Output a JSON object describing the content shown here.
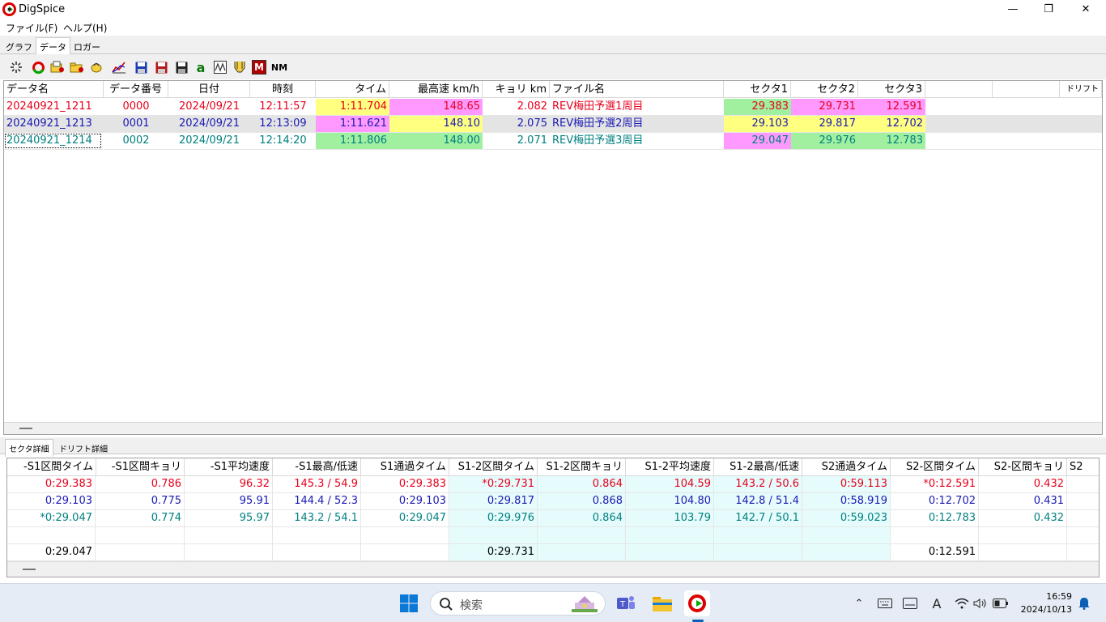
{
  "window": {
    "title": "DigSpice",
    "minimize": "—",
    "maximize": "❐",
    "close": "✕"
  },
  "menu": [
    {
      "label": "ファイル(F)"
    },
    {
      "label": "ヘルプ(H)"
    }
  ],
  "tabs_top": [
    {
      "label": "グラフ"
    },
    {
      "label": "データ"
    },
    {
      "label": "ロガー"
    }
  ],
  "toolbar_icons": [
    "new-icon",
    "lap-icon",
    "open-icon",
    "open-folder-icon",
    "import-icon",
    "graph-icon",
    "save-icon",
    "save-as-icon",
    "save-all-icon",
    "a-icon",
    "wave-icon",
    "filter-icon",
    "m-icon",
    "nm-icon"
  ],
  "toolbar_labels": {
    "a": "a",
    "m": "M",
    "nm": "NM"
  },
  "data_grid": {
    "columns": [
      "データ名",
      "データ番号",
      "日付",
      "時刻",
      "タイム",
      "最高速 km/h",
      "キョリ km",
      "ファイル名",
      "セクタ1",
      "セクタ2",
      "セクタ3",
      "",
      "ドリフト"
    ],
    "rows": [
      {
        "color": "#e8001c",
        "cells": [
          "20240921_1211",
          "0000",
          "2024/09/21",
          "12:11:57",
          "1:11.704",
          "148.65",
          "2.082",
          "REV梅田予選1周目",
          "29.383",
          "29.731",
          "12.591"
        ]
      },
      {
        "color": "#1a1ab4",
        "cells": [
          "20240921_1213",
          "0001",
          "2024/09/21",
          "12:13:09",
          "1:11.621",
          "148.10",
          "2.075",
          "REV梅田予選2周目",
          "29.103",
          "29.817",
          "12.702"
        ]
      },
      {
        "color": "#008080",
        "cells": [
          "20240921_1214",
          "0002",
          "2024/09/21",
          "12:14:20",
          "1:11.806",
          "148.00",
          "2.071",
          "REV梅田予選3周目",
          "29.047",
          "29.976",
          "12.783"
        ]
      }
    ]
  },
  "tabs_bottom": [
    {
      "label": "セクタ詳細"
    },
    {
      "label": "ドリフト詳細"
    }
  ],
  "sector_grid": {
    "columns": [
      "-S1区間タイム",
      "-S1区間キョリ",
      "-S1平均速度",
      "-S1最高/低速",
      "S1通過タイム",
      "S1-2区間タイム",
      "S1-2区間キョリ",
      "S1-2平均速度",
      "S1-2最高/低速",
      "S2通過タイム",
      "S2-区間タイム",
      "S2-区間キョリ",
      "S2"
    ],
    "rows": [
      {
        "color": "#e8001c",
        "cells": [
          "0:29.383",
          "0.786",
          "96.32",
          "145.3 / 54.9",
          "0:29.383",
          "*0:29.731",
          "0.864",
          "104.59",
          "143.2 / 50.6",
          "0:59.113",
          "*0:12.591",
          "0.432"
        ]
      },
      {
        "color": "#1a1ab4",
        "cells": [
          "0:29.103",
          "0.775",
          "95.91",
          "144.4 / 52.3",
          "0:29.103",
          "0:29.817",
          "0.868",
          "104.80",
          "142.8 / 51.4",
          "0:58.919",
          "0:12.702",
          "0.431"
        ]
      },
      {
        "color": "#008080",
        "cells": [
          "*0:29.047",
          "0.774",
          "95.97",
          "143.2 / 54.1",
          "0:29.047",
          "0:29.976",
          "0.864",
          "103.79",
          "142.7 / 50.1",
          "0:59.023",
          "0:12.783",
          "0.432"
        ]
      },
      {
        "color": "#000000",
        "cells": [
          "",
          "",
          "",
          "",
          "",
          "",
          "",
          "",
          "",
          "",
          "",
          ""
        ]
      },
      {
        "color": "#000000",
        "cells": [
          "0:29.047",
          "",
          "",
          "",
          "",
          "0:29.731",
          "",
          "",
          "",
          "",
          "0:12.591",
          ""
        ]
      }
    ]
  },
  "taskbar": {
    "search_placeholder": "検索",
    "time": "16:59",
    "date": "2024/10/13"
  },
  "colors": {
    "yellow": "#ffff80",
    "pink": "#ff99ff",
    "green": "#a0f0a0",
    "cyan": "#e6fcfc",
    "selected_row": "#e4e4e4"
  }
}
